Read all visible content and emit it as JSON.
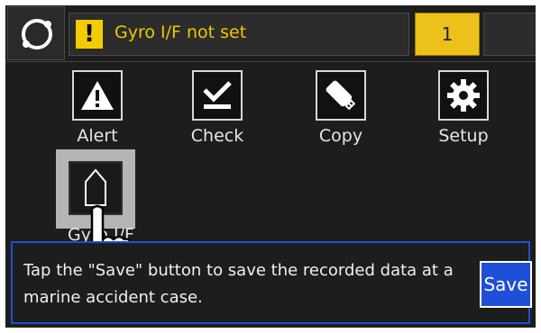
{
  "top_bar": {
    "alert_icon": "exclamation-icon",
    "alert_message": "Gyro I/F not set",
    "alert_count": "1"
  },
  "menu": {
    "items": [
      {
        "label": "Alert",
        "icon": "warning-triangle-icon"
      },
      {
        "label": "Check",
        "icon": "checkmark-icon"
      },
      {
        "label": "Copy",
        "icon": "usb-drive-icon"
      },
      {
        "label": "Setup",
        "icon": "gear-icon"
      },
      {
        "label": "Gyro I/F",
        "icon": "gyro-arrow-icon"
      }
    ]
  },
  "message": {
    "text": "Tap the \"Save\" button to save the recorded data at a marine accident case.",
    "save_label": "Save"
  },
  "colors": {
    "alert_yellow": "#f2c500",
    "count_yellow": "#ecc21a",
    "accent_blue": "#1f4fd8",
    "background": "#1d1d1d"
  }
}
